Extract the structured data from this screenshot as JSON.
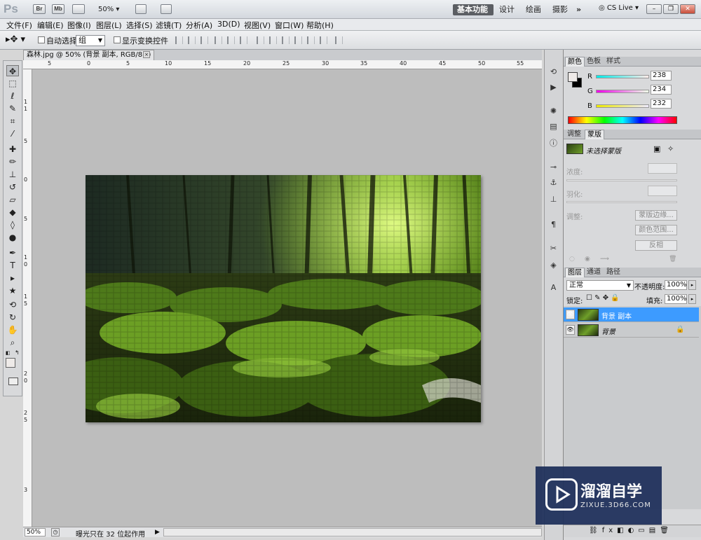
{
  "app": {
    "logo": "Ps",
    "bridge": "Br",
    "minibridge": "Mb",
    "zoom": "50%"
  },
  "workspaces": {
    "basic": "基本功能",
    "design": "设计",
    "paint": "绘画",
    "photo": "摄影",
    "more": "»",
    "cslive": "CS Live"
  },
  "menu": [
    "文件(F)",
    "编辑(E)",
    "图像(I)",
    "图层(L)",
    "选择(S)",
    "滤镜(T)",
    "分析(A)",
    "3D(D)",
    "视图(V)",
    "窗口(W)",
    "帮助(H)"
  ],
  "options": {
    "auto_select_label": "自动选择:",
    "auto_select_value": "组",
    "transform_label": "显示变换控件"
  },
  "document": {
    "tab_title": "森林.jpg @ 50% (背景 副本, RGB/8#) *",
    "close": "×"
  },
  "rulers": {
    "top": [
      "5",
      "0",
      "5",
      "10",
      "15",
      "20",
      "25",
      "30",
      "35",
      "40",
      "45",
      "50",
      "55"
    ],
    "left": [
      "1",
      "1",
      "5",
      "0",
      "5",
      "1",
      "0",
      "1",
      "5",
      "2",
      "0",
      "2",
      "5",
      "3"
    ]
  },
  "status": {
    "zoom": "50%",
    "text": "曝光只在 32 位起作用"
  },
  "color_panel": {
    "tabs": [
      "颜色",
      "色板",
      "样式"
    ],
    "r_label": "R",
    "g_label": "G",
    "b_label": "B",
    "r": "238",
    "g": "234",
    "b": "232"
  },
  "masks_panel": {
    "tabs": [
      "调整",
      "蒙版"
    ],
    "no_mask": "未选择蒙版",
    "density": "浓度:",
    "feather": "羽化:",
    "refine": "调整:",
    "mask_edge": "蒙版边缘...",
    "color_range": "颜色范围...",
    "invert": "反相"
  },
  "layers_panel": {
    "tabs": [
      "图层",
      "通道",
      "路径"
    ],
    "blend_mode": "正常",
    "opacity_label": "不透明度:",
    "opacity": "100%",
    "lock_label": "锁定:",
    "fill_label": "填充:",
    "fill": "100%",
    "layers": [
      {
        "name": "背景 副本",
        "selected": true
      },
      {
        "name": "背景",
        "selected": false,
        "locked": true
      }
    ]
  },
  "watermark": {
    "main": "溜溜自学",
    "sub": "ZIXUE.3D66.COM"
  },
  "colors": {
    "selected_layer": "#3d9bff",
    "canvas_bg": "#bdbdbd",
    "active_workspace": "#5b5e63"
  }
}
